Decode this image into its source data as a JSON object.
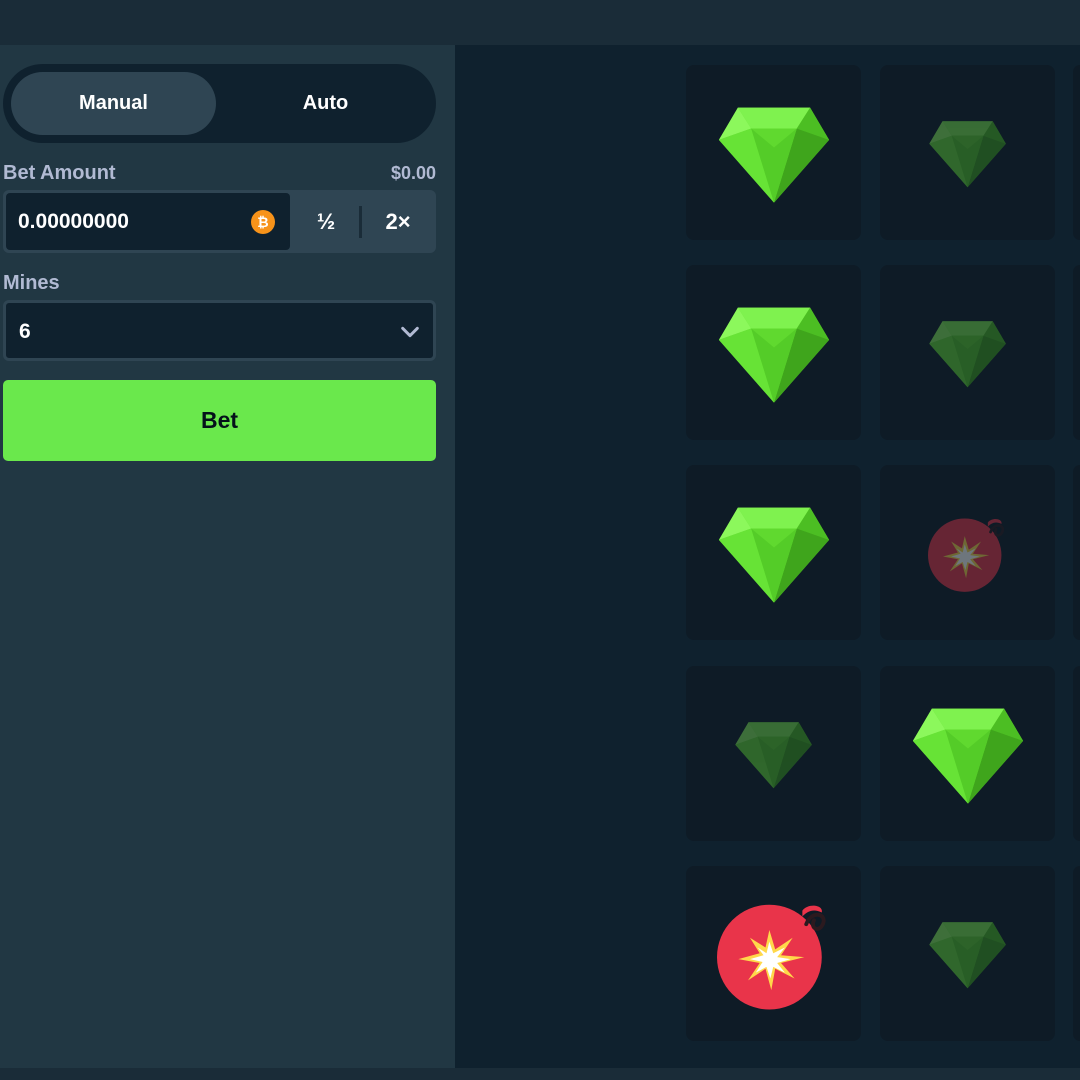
{
  "controls": {
    "mode_tabs": [
      {
        "label": "Manual",
        "active": true
      },
      {
        "label": "Auto",
        "active": false
      }
    ],
    "bet_amount": {
      "label": "Bet Amount",
      "usd_value": "$0.00",
      "value": "0.00000000",
      "currency_icon": "bitcoin-icon",
      "half_label": "½",
      "double_label": "2×"
    },
    "mines": {
      "label": "Mines",
      "selected": "6",
      "icon": "chevron-down-icon"
    },
    "bet_button_label": "Bet"
  },
  "board": {
    "tiles": [
      [
        "gem-revealed",
        "gem-faded"
      ],
      [
        "gem-revealed",
        "gem-faded"
      ],
      [
        "gem-revealed",
        "mine-faded"
      ],
      [
        "gem-faded",
        "gem-revealed"
      ],
      [
        "mine-revealed",
        "gem-faded"
      ]
    ]
  },
  "colors": {
    "accent_green": "#6ae84c",
    "gem_green": "#5cd82b",
    "mine_red": "#e9344a",
    "panel": "#213743",
    "tile": "#0e1b26"
  }
}
